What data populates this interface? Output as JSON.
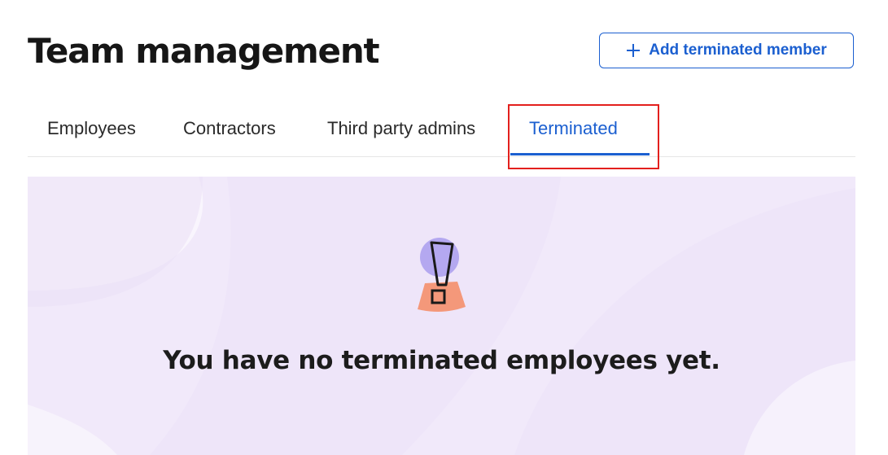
{
  "header": {
    "title": "Team management"
  },
  "actions": {
    "add_label": "Add terminated member",
    "add_icon": "plus-icon"
  },
  "tabs": [
    {
      "label": "Employees",
      "active": false
    },
    {
      "label": "Contractors",
      "active": false
    },
    {
      "label": "Third party admins",
      "active": false
    },
    {
      "label": "Terminated",
      "active": true
    }
  ],
  "empty_state": {
    "message": "You have no terminated employees yet.",
    "icon": "exclamation-illustration"
  },
  "colors": {
    "accent": "#1b5fd0",
    "highlight": "#e3201d",
    "panel_bg": "#f1e9fa",
    "illustration_circle": "#b4a8f0",
    "illustration_base": "#f4987a"
  }
}
